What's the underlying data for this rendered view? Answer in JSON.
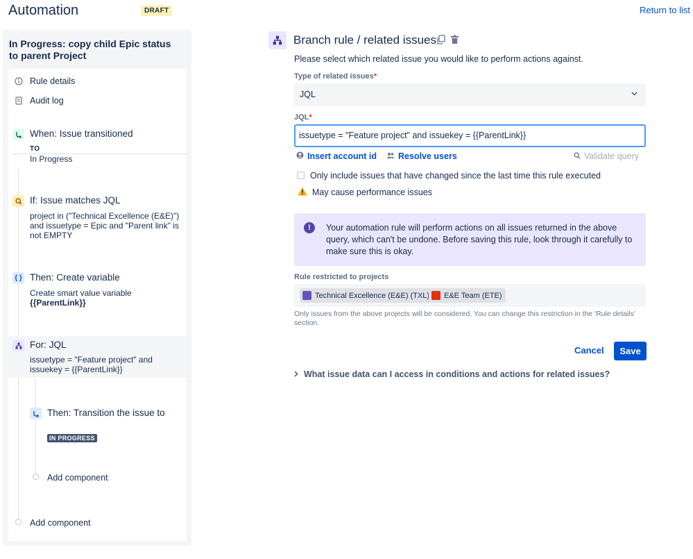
{
  "header": {
    "title": "Automation",
    "badge": "DRAFT",
    "return_link": "Return to list"
  },
  "sidebar": {
    "rule_name": "In Progress: copy child Epic status to parent Project",
    "nav": [
      {
        "label": "Rule details",
        "icon": "info-icon"
      },
      {
        "label": "Audit log",
        "icon": "document-icon"
      }
    ],
    "components": [
      {
        "title": "When: Issue transitioned",
        "to_label": "TO",
        "desc": "In Progress",
        "icon": "transition-icon"
      },
      {
        "title": "If: Issue matches JQL",
        "desc": "project in (\"Technical Excellence (E&E)\") and issuetype = Epic and \"Parent link\" is not EMPTY",
        "icon": "search-icon"
      },
      {
        "title": "Then: Create variable",
        "desc": "Create smart value variable",
        "desc_bold": "{{ParentLink}}",
        "icon": "braces-icon"
      },
      {
        "title": "For: JQL",
        "desc": "issuetype = \"Feature project\" and issuekey = {{ParentLink}}",
        "icon": "branch-icon"
      },
      {
        "title": "Then: Transition the issue to",
        "lozenge": "IN PROGRESS",
        "icon": "transition-icon"
      }
    ],
    "add_component_nested": "Add component",
    "add_component": "Add component"
  },
  "main": {
    "title": "Branch rule / related issues",
    "lead": "Please select which related issue you would like to perform actions against.",
    "type_label": "Type of related issues",
    "type_value": "JQL",
    "jql_label": "JQL",
    "jql_value": "issuetype = \"Feature project\" and issuekey = {{ParentLink}}",
    "insert_account": "Insert account id",
    "resolve_users": "Resolve users",
    "validate_query": "Validate query",
    "checkbox_label": "Only include issues that have changed since the last time this rule executed",
    "checkbox_checked": false,
    "warning": "May cause performance issues",
    "info_text": "Your automation rule will perform actions on all issues returned in the above query, which can't be undone. Before saving this rule, look through it carefully to make sure this is okay.",
    "projects_label": "Rule restricted to projects",
    "projects": [
      {
        "label": "Technical Excellence (E&E) (TXL)",
        "color": "#6554c0"
      },
      {
        "label": "E&E Team (ETE)",
        "color": "#de350b"
      }
    ],
    "projects_hint": "Only issues from the above projects will be considered. You can change this restriction in the 'Rule details' section.",
    "cancel": "Cancel",
    "save": "Save",
    "expander": "What issue data can I access in conditions and actions for related issues?"
  },
  "colors": {
    "primary": "#0052cc",
    "info_bg": "#eae6ff",
    "warning": "#ffab00"
  }
}
